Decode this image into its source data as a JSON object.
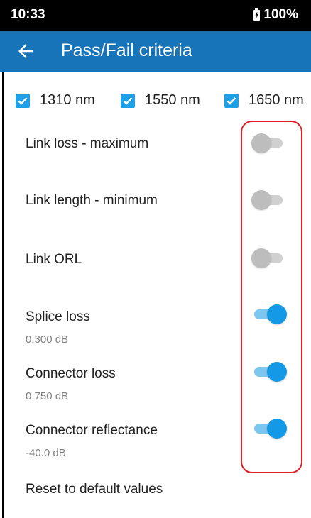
{
  "status_bar": {
    "time": "10:33",
    "battery": "100%"
  },
  "app_bar": {
    "title": "Pass/Fail criteria",
    "back_icon": "arrow-left-icon"
  },
  "wavelengths": [
    {
      "label": "1310 nm",
      "checked": true
    },
    {
      "label": "1550 nm",
      "checked": true
    },
    {
      "label": "1650 nm",
      "checked": true
    }
  ],
  "settings": [
    {
      "title": "Link loss - maximum",
      "value": "",
      "enabled": false
    },
    {
      "title": "Link length - minimum",
      "value": "",
      "enabled": false
    },
    {
      "title": "Link ORL",
      "value": "",
      "enabled": false
    },
    {
      "title": "Splice loss",
      "value": "0.300 dB",
      "enabled": true
    },
    {
      "title": "Connector loss",
      "value": "0.750 dB",
      "enabled": true
    },
    {
      "title": "Connector reflectance",
      "value": "-40.0 dB",
      "enabled": true
    }
  ],
  "reset_label": "Reset to default values",
  "colors": {
    "app_bar": "#1774b9",
    "accent": "#1499e6",
    "highlight": "#e31e26"
  }
}
